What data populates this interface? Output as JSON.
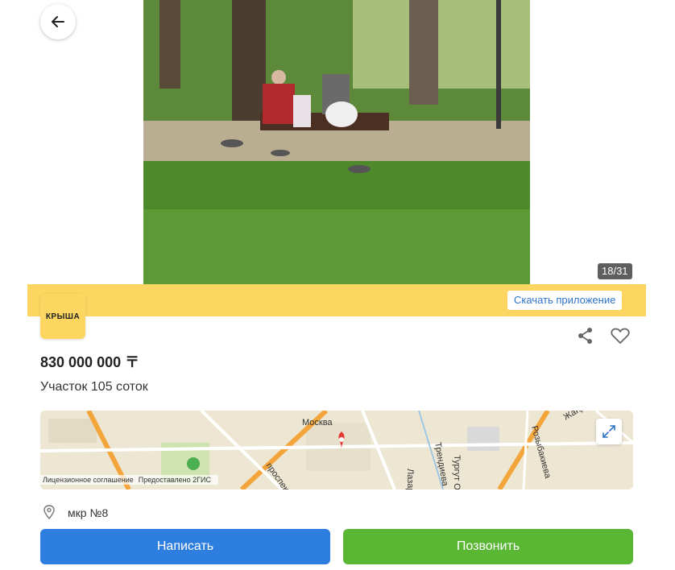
{
  "gallery": {
    "counter": "18/31"
  },
  "banner": {
    "download_label": "Скачать приложение"
  },
  "logo": {
    "text": "КРЫША"
  },
  "listing": {
    "price": "830 000 000 〒",
    "title": "Участок 105 соток",
    "location": "мкр №8"
  },
  "map": {
    "labels": [
      "Москва",
      "Тургут Озала",
      "Розыбакиева",
      "Жандосова",
      "Трендиева",
      "проспект",
      "Лазаре"
    ],
    "license": "Лицензионное соглашение",
    "provided_by": "Предоставлено 2ГИС"
  },
  "actions": {
    "write_label": "Написать",
    "call_label": "Позвонить"
  },
  "colors": {
    "banner": "#fcd660",
    "write_button": "#2d7ede",
    "call_button": "#5ab734",
    "link": "#2f73c9",
    "map_pin": "#e53935"
  },
  "icons": [
    "back-arrow-icon",
    "share-icon",
    "heart-icon",
    "expand-icon",
    "location-pin-icon"
  ]
}
